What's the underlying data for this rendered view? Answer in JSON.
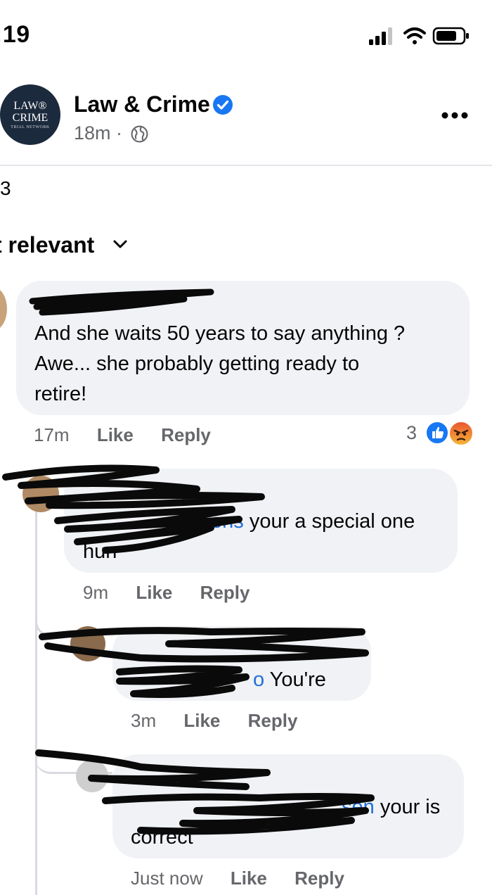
{
  "status_bar": {
    "time": ":19"
  },
  "post": {
    "page_name": "Law & Crime",
    "avatar": {
      "line1": "LAW®",
      "line2": "CRIME",
      "line3": "TRIAL NETWORK"
    },
    "time": "18m ·",
    "comment_count": "3",
    "sort_label": "t relevant"
  },
  "comments": [
    {
      "text_lines": [
        "And she waits 50 years to say anything ?",
        "Awe... she probably getting ready to",
        "retire!"
      ],
      "time": "17m",
      "like": "Like",
      "reply": "Reply",
      "reaction_count": "3"
    },
    {
      "mention": "Jennifer Atkins",
      "mention_visible": "ons",
      "text_line1": " your a special one",
      "text_line2": "hun",
      "time": "9m",
      "like": "Like",
      "reply": "Reply"
    },
    {
      "mention_visible": "o",
      "text": " You're",
      "time": "3m",
      "like": "Like",
      "reply": "Reply"
    },
    {
      "mention_visible": "sen",
      "text_line1": " your is",
      "text_line2": "correct",
      "time": "Just now",
      "like": "Like",
      "reply": "Reply"
    }
  ],
  "colors": {
    "accent": "#1877f2",
    "mention": "#216fdb",
    "bubble": "#f0f2f5",
    "meta": "#65676b"
  }
}
